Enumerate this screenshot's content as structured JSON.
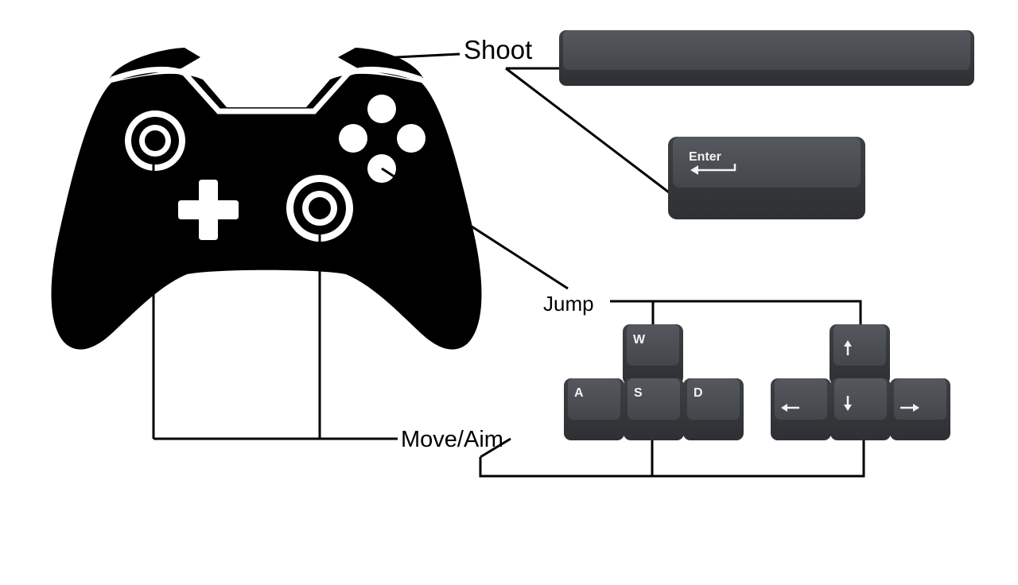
{
  "labels": {
    "shoot": "Shoot",
    "jump": "Jump",
    "move_aim": "Move/Aim"
  },
  "keys": {
    "enter": "Enter",
    "w": "W",
    "a": "A",
    "s": "S",
    "d": "D"
  },
  "icons": {
    "controller": "gamepad-icon",
    "enter_arrow": "return-arrow-icon",
    "arrow_up": "arrow-up-icon",
    "arrow_down": "arrow-down-icon",
    "arrow_left": "arrow-left-icon",
    "arrow_right": "arrow-right-icon"
  },
  "colors": {
    "controller": "#000000",
    "key_top": "#4a4d52",
    "key_side": "#3a3c40",
    "key_text": "#f2f2f2",
    "connector": "#000000"
  }
}
